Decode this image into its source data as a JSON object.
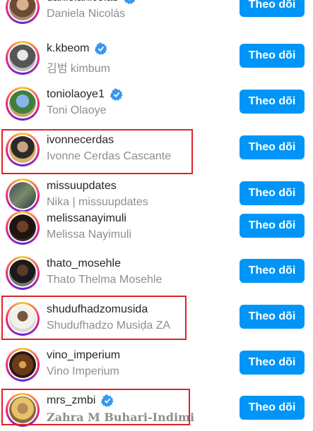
{
  "accounts": [
    {
      "username": "danielanicolas",
      "fullname": "Daniela Nicolás",
      "verified": true,
      "button": "Theo dõi"
    },
    {
      "username": "k.kbeom",
      "fullname": "김범 kimbum",
      "verified": true,
      "button": "Theo dõi"
    },
    {
      "username": "toniolaoye1",
      "fullname": "Toni Olaoye",
      "verified": true,
      "button": "Theo dõi"
    },
    {
      "username": "ivonnecerdas",
      "fullname": "Ivonne Cerdas Cascante",
      "verified": false,
      "button": "Theo dõi"
    },
    {
      "username": "missuupdates",
      "fullname": "Nika | missuupdates",
      "verified": false,
      "button": "Theo dõi"
    },
    {
      "username": "melissanayimuli",
      "fullname": "Melissa Nayimuli",
      "verified": false,
      "button": "Theo dõi"
    },
    {
      "username": "thato_mosehle",
      "fullname": "Thato Thelma Mosehle",
      "verified": false,
      "button": "Theo dõi"
    },
    {
      "username": "shudufhadzomusida",
      "fullname": "Shudufhadzo Musiḍa ZA",
      "verified": false,
      "button": "Theo dõi"
    },
    {
      "username": "vino_imperium",
      "fullname": "Vino Imperium",
      "verified": false,
      "button": "Theo dõi"
    },
    {
      "username": "mrs_zmbi",
      "fullname": "Zahra M Buhari-Indimi",
      "verified": true,
      "button": "Theo dõi"
    }
  ],
  "colors": {
    "accent": "#0095f6",
    "highlight": "#e0222a",
    "verified": "#3897f0"
  }
}
